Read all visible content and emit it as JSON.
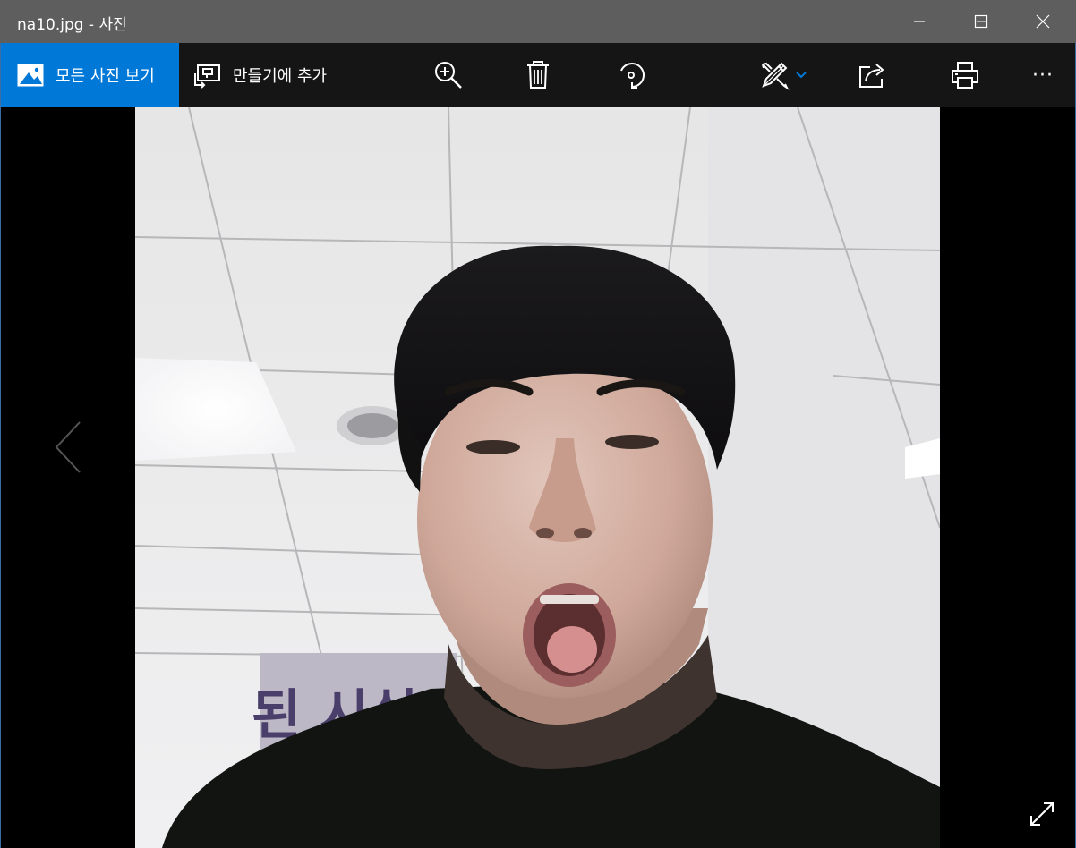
{
  "window": {
    "title": "na10.jpg - 사진"
  },
  "titlebar_controls": [
    {
      "name": "minimize",
      "icon": "minimize-icon"
    },
    {
      "name": "maximize",
      "icon": "maximize-icon"
    },
    {
      "name": "close",
      "icon": "close-icon"
    }
  ],
  "toolbar": {
    "all_photos_label": "모든 사진 보기",
    "all_photos_icon": "photo-landscape-icon",
    "create_label": "만들기에 추가",
    "create_icon": "add-to-creation-icon",
    "zoom_icon": "zoom-in-icon",
    "delete_icon": "trash-icon",
    "rotate_icon": "rotate-icon",
    "edit_icon": "edit-create-icon",
    "edit_dropdown_icon": "chevron-down-icon",
    "share_icon": "share-icon",
    "print_icon": "print-icon",
    "more_label": "···",
    "accent_color": "#0078d7"
  },
  "viewer": {
    "photo_description_icon": "photo",
    "prev_icon": "chevron-left-icon",
    "fullscreen_icon": "expand-icon"
  }
}
